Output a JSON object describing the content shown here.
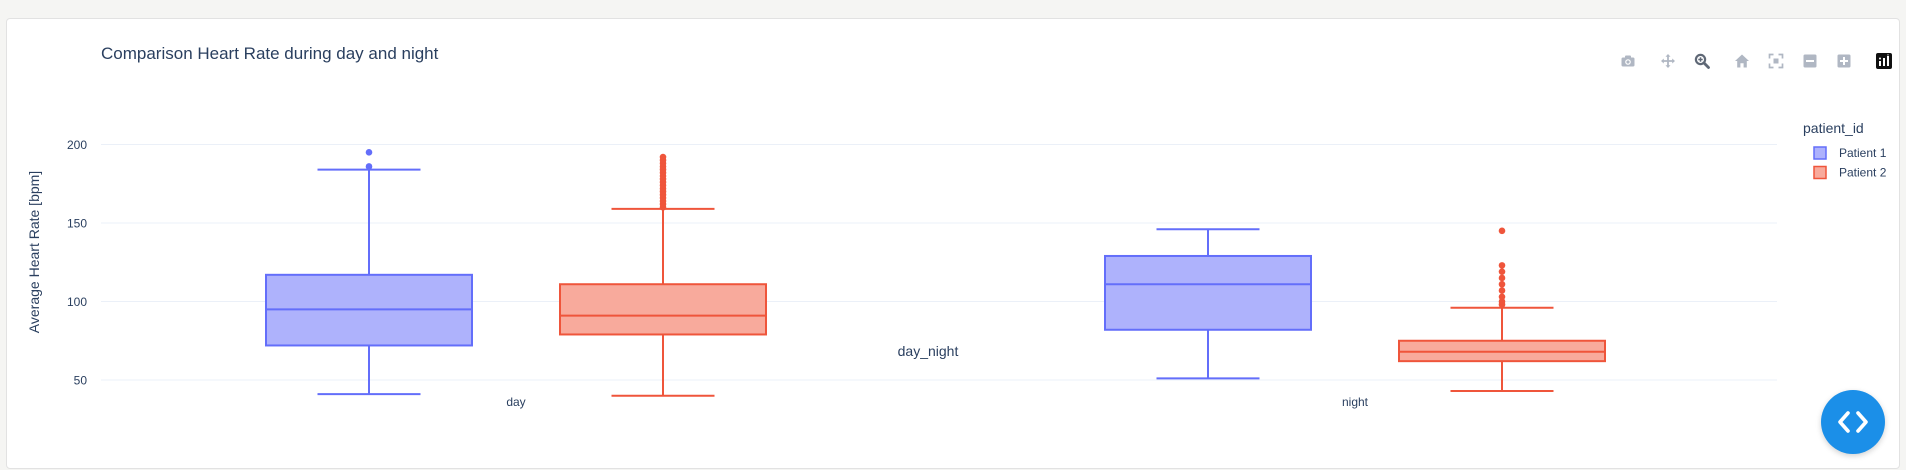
{
  "chart_data": {
    "type": "box",
    "title": "Comparison Heart Rate  during day and night",
    "xlabel": "day_night",
    "ylabel": "Average Heart Rate [bpm]",
    "categories": [
      "day",
      "night"
    ],
    "ylim": [
      35,
      205
    ],
    "yticks": [
      50,
      100,
      150,
      200
    ],
    "grid": true,
    "legend": {
      "title": "patient_id",
      "position": "top-right"
    },
    "series": [
      {
        "name": "Patient 1",
        "color": "#636efa",
        "fill": "#aeb2fc",
        "boxes": [
          {
            "category": "day",
            "lowerfence": 41,
            "q1": 72,
            "median": 95,
            "q3": 117,
            "upperfence": 184,
            "outliers": [
              186,
              195
            ]
          },
          {
            "category": "night",
            "lowerfence": 51,
            "q1": 82,
            "median": 111,
            "q3": 129,
            "upperfence": 146,
            "outliers": []
          }
        ]
      },
      {
        "name": "Patient 2",
        "color": "#ef553b",
        "fill": "#f8aa9c",
        "boxes": [
          {
            "category": "day",
            "lowerfence": 40,
            "q1": 79,
            "median": 91,
            "q3": 111,
            "upperfence": 159,
            "outliers": [
              160,
              162,
              164,
              166,
              168,
              170,
              172,
              174,
              176,
              178,
              180,
              182,
              184,
              186,
              188,
              190,
              192
            ]
          },
          {
            "category": "night",
            "lowerfence": 43,
            "q1": 62,
            "median": 68,
            "q3": 75,
            "upperfence": 96,
            "outliers": [
              98,
              100,
              103,
              107,
              111,
              115,
              119,
              123,
              145
            ]
          }
        ]
      }
    ]
  },
  "modebar": {
    "buttons": [
      {
        "name": "camera-icon",
        "title": "Download plot as a png"
      },
      {
        "name": "pan-icon",
        "title": "Pan"
      },
      {
        "name": "zoom-icon",
        "title": "Zoom"
      },
      {
        "name": "home-icon",
        "title": "Reset axes"
      },
      {
        "name": "autoscale-icon",
        "title": "Autoscale"
      },
      {
        "name": "zoom-out-icon",
        "title": "Zoom out"
      },
      {
        "name": "zoom-in-icon",
        "title": "Zoom in"
      },
      {
        "name": "plotly-logo-icon",
        "title": "Produced with Plotly"
      }
    ]
  },
  "fab": {
    "icon": "code-icon"
  },
  "colors": {
    "text": "#2a3f5f",
    "grid": "#ebf0f8",
    "accent": "#1b8fe8"
  }
}
